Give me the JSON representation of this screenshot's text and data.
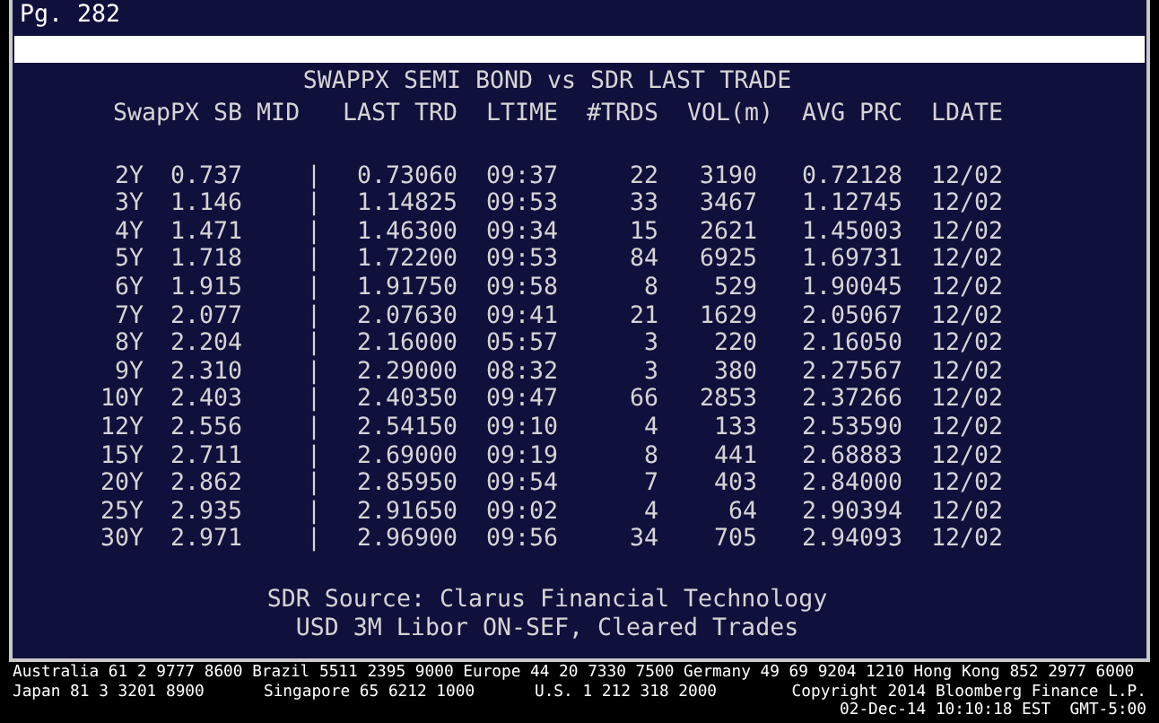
{
  "page_label": "Pg. 282",
  "title": "SWAPPX SEMI BOND vs SDR LAST TRADE",
  "columns": [
    "SwapPX SB MID",
    "LAST TRD",
    "LTIME",
    "#TRDS",
    "VOL(m)",
    "AVG PRC",
    "LDATE"
  ],
  "rows": [
    {
      "tenor": "2Y",
      "mid": "0.737",
      "divider": "|",
      "last_trd": "0.73060",
      "ltime": "09:37",
      "trds": "22",
      "vol": "3190",
      "avg_prc": "0.72128",
      "ldate": "12/02"
    },
    {
      "tenor": "3Y",
      "mid": "1.146",
      "divider": "|",
      "last_trd": "1.14825",
      "ltime": "09:53",
      "trds": "33",
      "vol": "3467",
      "avg_prc": "1.12745",
      "ldate": "12/02"
    },
    {
      "tenor": "4Y",
      "mid": "1.471",
      "divider": "|",
      "last_trd": "1.46300",
      "ltime": "09:34",
      "trds": "15",
      "vol": "2621",
      "avg_prc": "1.45003",
      "ldate": "12/02"
    },
    {
      "tenor": "5Y",
      "mid": "1.718",
      "divider": "|",
      "last_trd": "1.72200",
      "ltime": "09:53",
      "trds": "84",
      "vol": "6925",
      "avg_prc": "1.69731",
      "ldate": "12/02"
    },
    {
      "tenor": "6Y",
      "mid": "1.915",
      "divider": "|",
      "last_trd": "1.91750",
      "ltime": "09:58",
      "trds": "8",
      "vol": "529",
      "avg_prc": "1.90045",
      "ldate": "12/02"
    },
    {
      "tenor": "7Y",
      "mid": "2.077",
      "divider": "|",
      "last_trd": "2.07630",
      "ltime": "09:41",
      "trds": "21",
      "vol": "1629",
      "avg_prc": "2.05067",
      "ldate": "12/02"
    },
    {
      "tenor": "8Y",
      "mid": "2.204",
      "divider": "|",
      "last_trd": "2.16000",
      "ltime": "05:57",
      "trds": "3",
      "vol": "220",
      "avg_prc": "2.16050",
      "ldate": "12/02"
    },
    {
      "tenor": "9Y",
      "mid": "2.310",
      "divider": "|",
      "last_trd": "2.29000",
      "ltime": "08:32",
      "trds": "3",
      "vol": "380",
      "avg_prc": "2.27567",
      "ldate": "12/02"
    },
    {
      "tenor": "10Y",
      "mid": "2.403",
      "divider": "|",
      "last_trd": "2.40350",
      "ltime": "09:47",
      "trds": "66",
      "vol": "2853",
      "avg_prc": "2.37266",
      "ldate": "12/02"
    },
    {
      "tenor": "12Y",
      "mid": "2.556",
      "divider": "|",
      "last_trd": "2.54150",
      "ltime": "09:10",
      "trds": "4",
      "vol": "133",
      "avg_prc": "2.53590",
      "ldate": "12/02"
    },
    {
      "tenor": "15Y",
      "mid": "2.711",
      "divider": "|",
      "last_trd": "2.69000",
      "ltime": "09:19",
      "trds": "8",
      "vol": "441",
      "avg_prc": "2.68883",
      "ldate": "12/02"
    },
    {
      "tenor": "20Y",
      "mid": "2.862",
      "divider": "|",
      "last_trd": "2.85950",
      "ltime": "09:54",
      "trds": "7",
      "vol": "403",
      "avg_prc": "2.84000",
      "ldate": "12/02"
    },
    {
      "tenor": "25Y",
      "mid": "2.935",
      "divider": "|",
      "last_trd": "2.91650",
      "ltime": "09:02",
      "trds": "4",
      "vol": "64",
      "avg_prc": "2.90394",
      "ldate": "12/02"
    },
    {
      "tenor": "30Y",
      "mid": "2.971",
      "divider": "|",
      "last_trd": "2.96900",
      "ltime": "09:56",
      "trds": "34",
      "vol": "705",
      "avg_prc": "2.94093",
      "ldate": "12/02"
    }
  ],
  "notes": [
    "SDR Source: Clarus Financial Technology",
    "USD 3M Libor ON-SEF, Cleared Trades"
  ],
  "footer": {
    "line_1": "Australia 61 2 9777 8600 Brazil 5511 2395 9000 Europe 44 20 7330 7500 Germany 49 69 9204 1210 Hong Kong 852 2977 6000",
    "line_2": [
      "Japan 81 3 3201 8900",
      "Singapore 65 6212 1000",
      "U.S. 1 212 318 2000",
      "Copyright 2014 Bloomberg Finance L.P."
    ],
    "timestamp": "02-Dec-14 10:10:18 EST  GMT-5:00"
  }
}
